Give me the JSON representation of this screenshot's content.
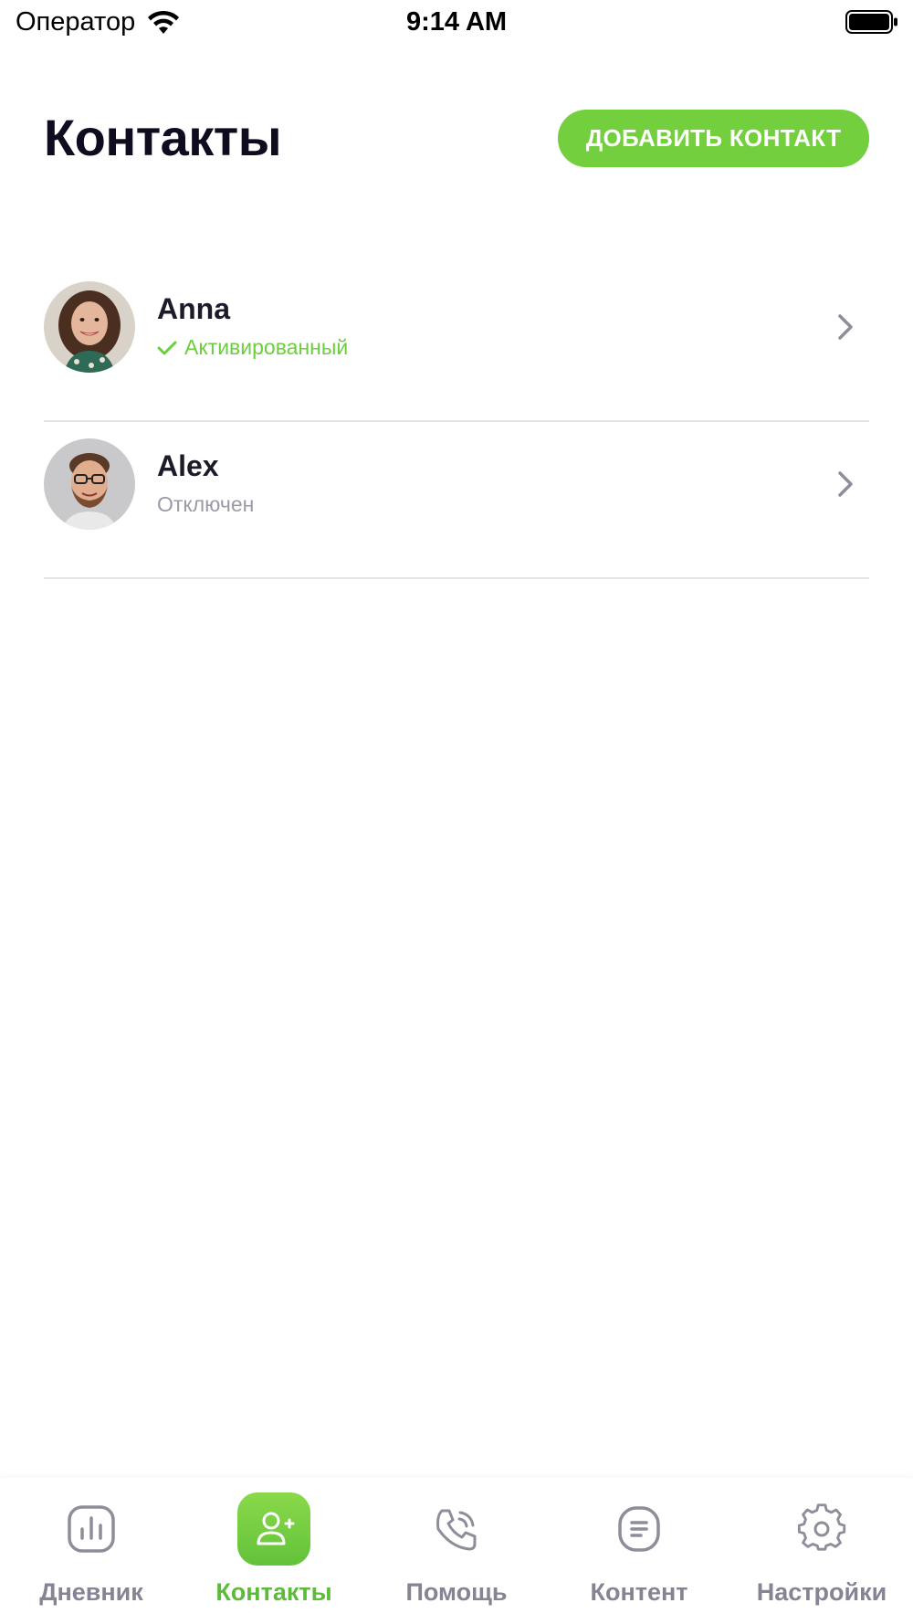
{
  "status_bar": {
    "carrier": "Оператор",
    "time": "9:14 AM"
  },
  "header": {
    "title": "Контакты",
    "add_button_label": "ДОБАВИТЬ КОНТАКТ"
  },
  "contacts": [
    {
      "name": "Anna",
      "status": "Активированный",
      "status_kind": "active",
      "avatar": "woman-photo"
    },
    {
      "name": "Alex",
      "status": "Отключен",
      "status_kind": "disabled",
      "avatar": "man-photo"
    }
  ],
  "tab_bar": {
    "tabs": [
      {
        "label": "Дневник",
        "icon": "chart-icon",
        "active": false
      },
      {
        "label": "Контакты",
        "icon": "add-user-icon",
        "active": true
      },
      {
        "label": "Помощь",
        "icon": "phone-icon",
        "active": false
      },
      {
        "label": "Контент",
        "icon": "document-icon",
        "active": false
      },
      {
        "label": "Настройки",
        "icon": "gear-icon",
        "active": false
      }
    ]
  },
  "colors": {
    "accent": "#74cf3f",
    "active_status": "#6ccd3e",
    "inactive_text": "#9b9aa6",
    "tab_inactive": "#858495"
  }
}
